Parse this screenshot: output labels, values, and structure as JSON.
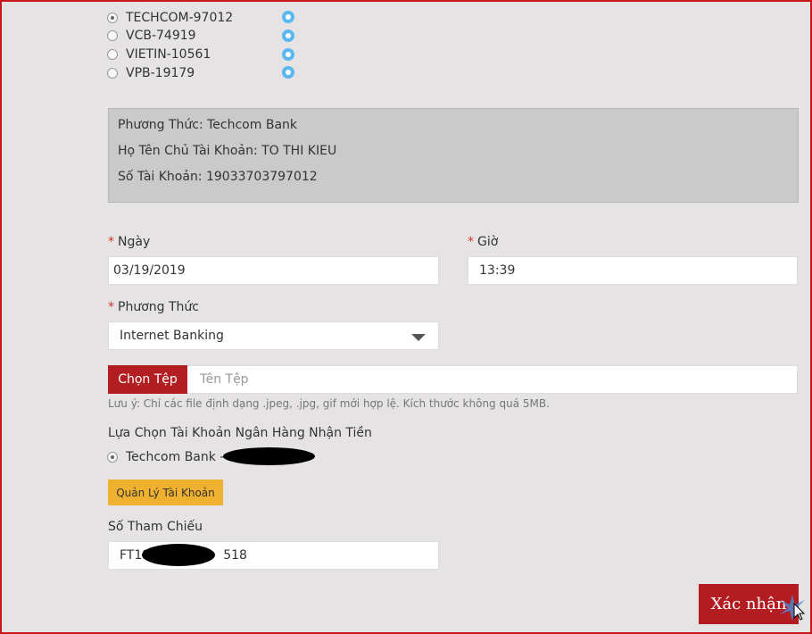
{
  "banks": [
    {
      "label": "TECHCOM-97012",
      "selected": true
    },
    {
      "label": "VCB-74919",
      "selected": false
    },
    {
      "label": "VIETIN-10561",
      "selected": false
    },
    {
      "label": "VPB-19179",
      "selected": false
    }
  ],
  "info": {
    "method": "Phương Thức: Techcom Bank",
    "holder": "Họ Tên Chủ Tài Khoản: TO THI KIEU",
    "account": "Số Tài Khoản: 19033703797012"
  },
  "form": {
    "date_label": "Ngày",
    "date_value": "03/19/2019",
    "time_label": "Giờ",
    "time_value": "13:39",
    "method_label": "Phương Thức",
    "method_value": "Internet Banking",
    "required_mark": "*",
    "file_button": "Chọn Tệp",
    "file_placeholder": "Tên Tệp",
    "file_note": "Lưu ý: Chỉ các file định dạng .jpeg, .jpg, gif mới hợp lệ. Kích thước không quá 5MB.",
    "receive_label": "Lựa Chọn Tài Khoản Ngân Hàng Nhận Tiền",
    "receive_option": "Techcom Bank -",
    "manage_button": "Quản Lý Tài Khoản",
    "reference_label": "Số Tham Chiếu",
    "reference_prefix": "FT19",
    "reference_suffix": "518",
    "confirm_button": "Xác nhận"
  },
  "colors": {
    "accent": "#b21e22",
    "info_dot": "#5bb8ee",
    "manage_button": "#efb12f"
  }
}
